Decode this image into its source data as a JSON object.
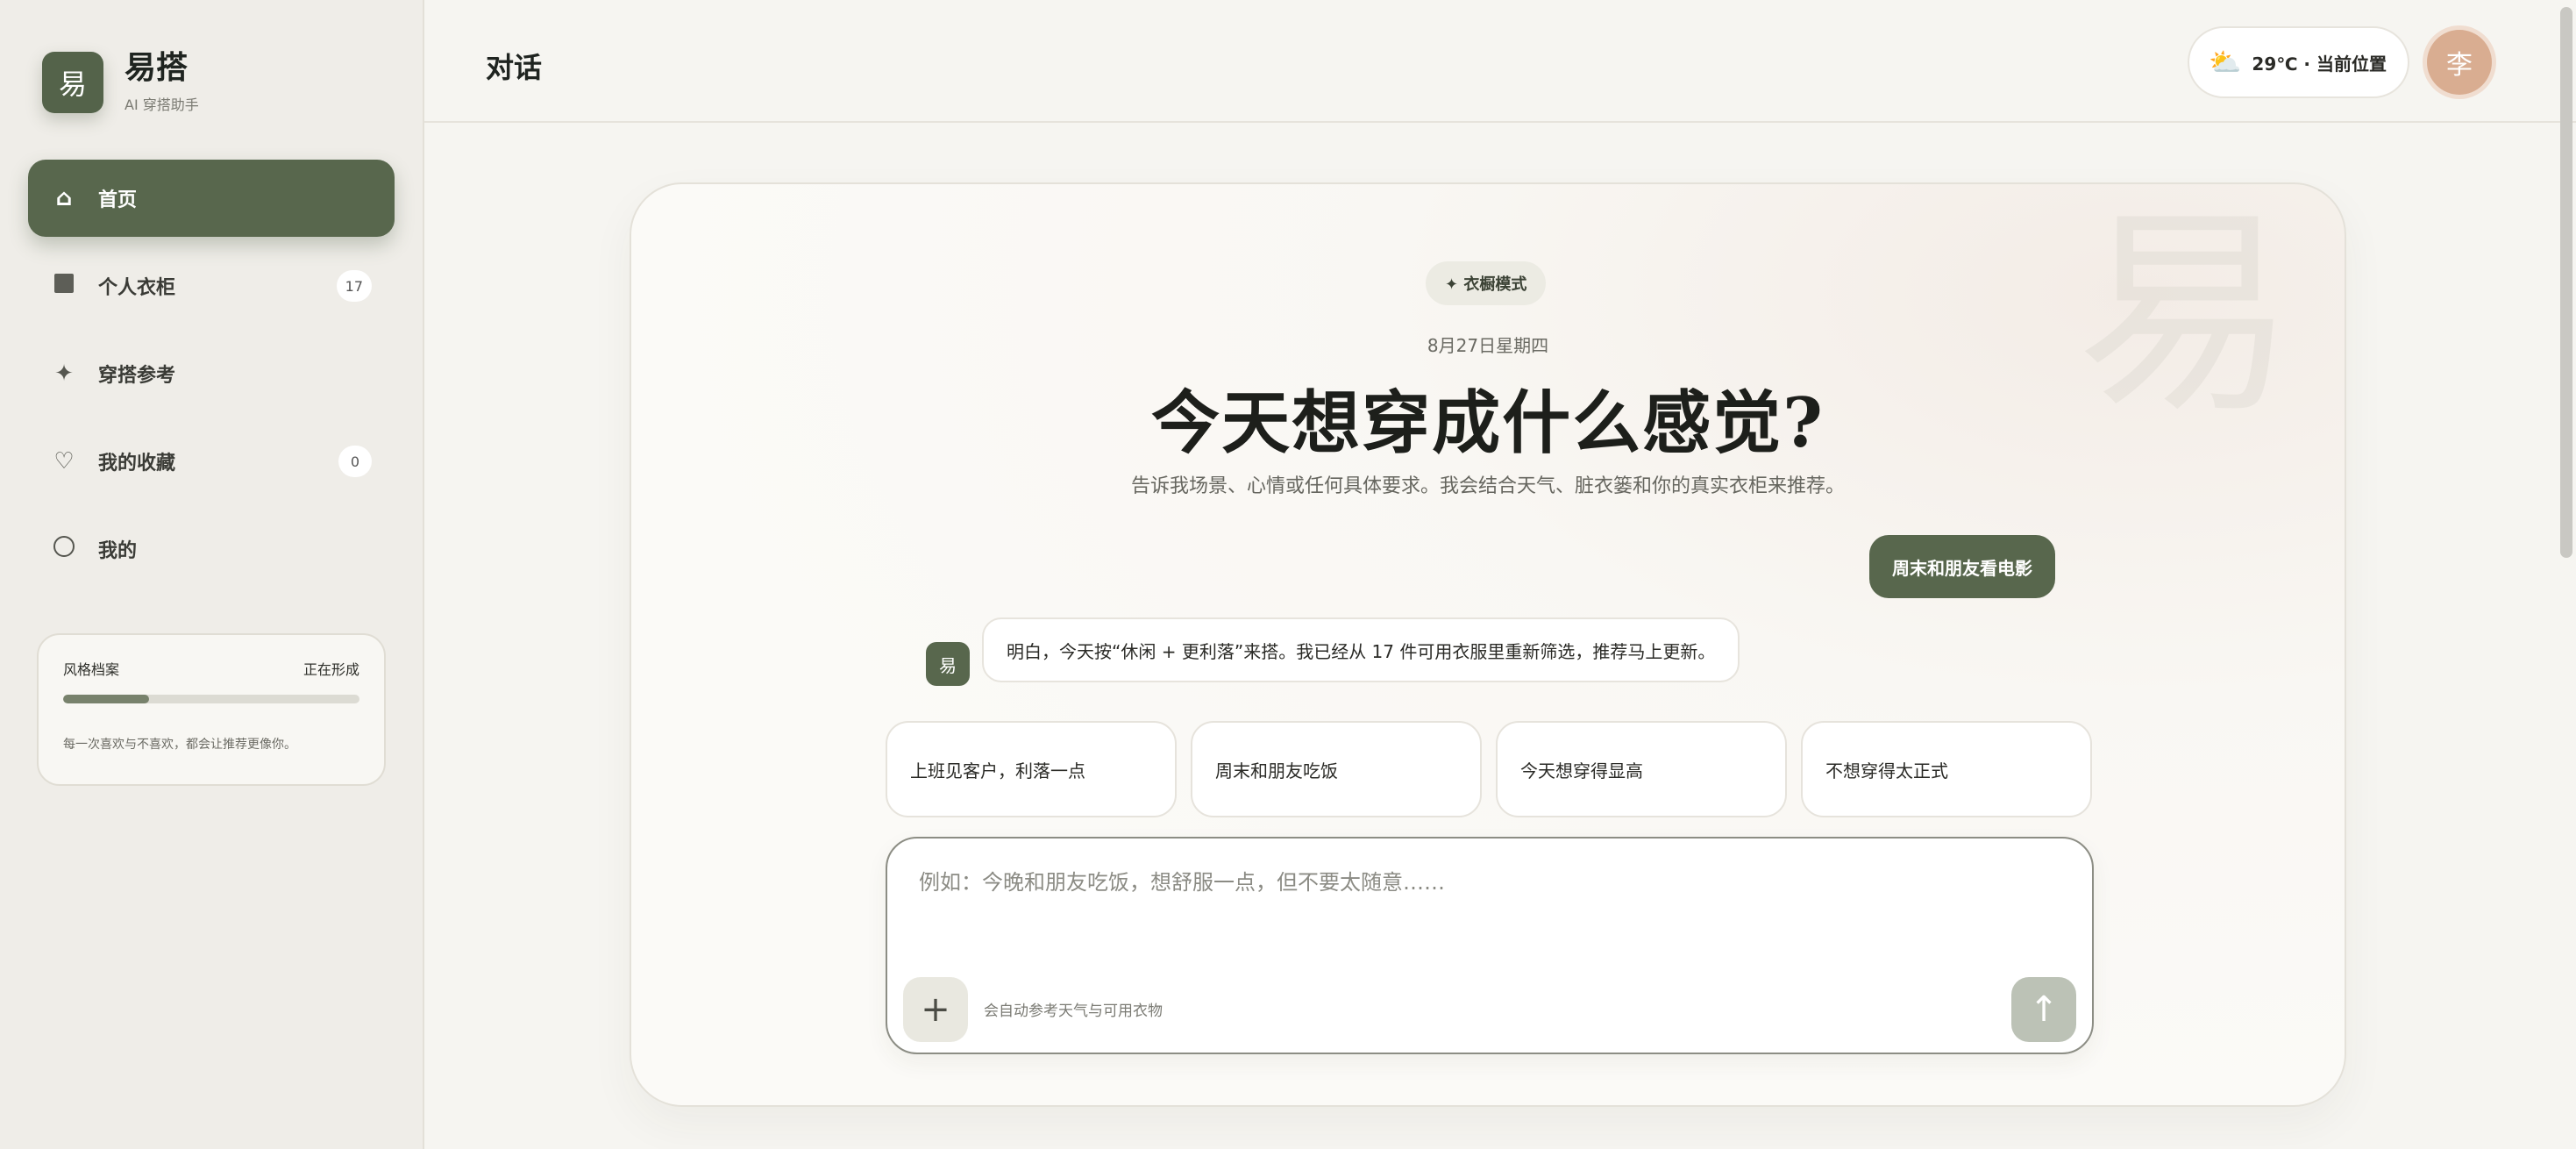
{
  "brand": {
    "logo_char": "易",
    "name": "易搭",
    "subtitle": "AI 穿搭助手"
  },
  "nav": [
    {
      "label": "首页",
      "icon": "home-icon",
      "glyph": "⌂",
      "active": true
    },
    {
      "label": "个人衣柜",
      "icon": "wardrobe-icon",
      "badge": "17"
    },
    {
      "label": "穿搭参考",
      "icon": "sparkle-icon",
      "glyph": "✦"
    },
    {
      "label": "我的收藏",
      "icon": "heart-icon",
      "glyph": "♡",
      "badge": "0"
    },
    {
      "label": "我的",
      "icon": "profile-icon"
    }
  ],
  "style_profile": {
    "title": "风格档案",
    "status": "正在形成",
    "progress": 0.29,
    "note": "每一次喜欢与不喜欢，都会让推荐更像你。"
  },
  "header": {
    "title": "对话",
    "weather": {
      "icon": "partly-cloudy-icon",
      "glyph": "⛅",
      "text": "29℃ · 当前位置"
    },
    "avatar_char": "李"
  },
  "hero": {
    "watermark": "易",
    "mode_badge": "✦ 衣橱模式",
    "date": "8月27日星期四",
    "headline": "今天想穿成什么感觉?",
    "subline": "告诉我场景、心情或任何具体要求。我会结合天气、脏衣篓和你的真实衣柜来推荐。"
  },
  "chat": {
    "user_message": "周末和朋友看电影",
    "bot_avatar_char": "易",
    "bot_message": "明白，今天按“休闲 + 更利落”来搭。我已经从 17 件可用衣服里重新筛选，推荐马上更新。"
  },
  "suggestions": [
    "上班见客户，利落一点",
    "周末和朋友吃饭",
    "今天想穿得显高",
    "不想穿得太正式"
  ],
  "composer": {
    "placeholder": "例如：今晚和朋友吃饭，想舒服一点，但不要太随意……",
    "value": "",
    "add_glyph": "+",
    "hint": "会自动参考天气与可用衣物",
    "send_glyph": "↑"
  },
  "colors": {
    "accent": "#58674d",
    "background": "#f6f5f1",
    "sidebar": "#efede8"
  }
}
